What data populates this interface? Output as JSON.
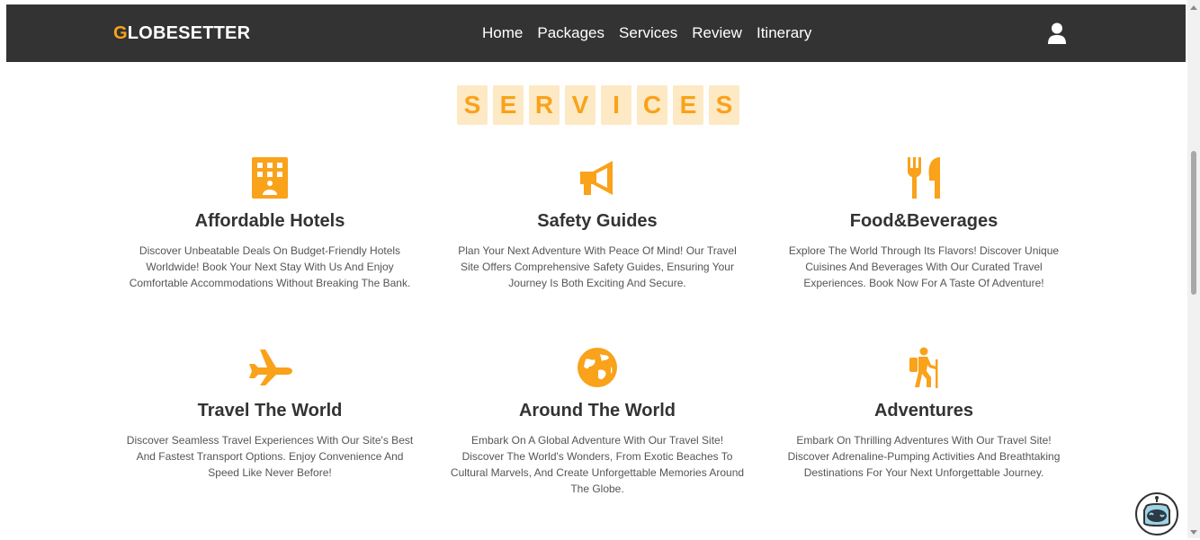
{
  "nav": {
    "logo_first": "G",
    "logo_rest": "LOBESETTER",
    "links": [
      "Home",
      "Packages",
      "Services",
      "Review",
      "Itinerary"
    ],
    "user_icon": "user-icon"
  },
  "section": {
    "title_letters": [
      "S",
      "E",
      "R",
      "V",
      "I",
      "C",
      "E",
      "S"
    ]
  },
  "services": [
    {
      "icon": "hotel-icon",
      "title": "Affordable Hotels",
      "description": "Discover Unbeatable Deals On Budget-Friendly Hotels Worldwide! Book Your Next Stay With Us And Enjoy Comfortable Accommodations Without Breaking The Bank."
    },
    {
      "icon": "megaphone-icon",
      "title": "Safety Guides",
      "description": "Plan Your Next Adventure With Peace Of Mind! Our Travel Site Offers Comprehensive Safety Guides, Ensuring Your Journey Is Both Exciting And Secure."
    },
    {
      "icon": "utensils-icon",
      "title": "Food&Beverages",
      "description": "Explore The World Through Its Flavors! Discover Unique Cuisines And Beverages With Our Curated Travel Experiences. Book Now For A Taste Of Adventure!"
    },
    {
      "icon": "plane-icon",
      "title": "Travel The World",
      "description": "Discover Seamless Travel Experiences With Our Site's Best And Fastest Transport Options. Enjoy Convenience And Speed Like Never Before!"
    },
    {
      "icon": "globe-icon",
      "title": "Around The World",
      "description": "Embark On A Global Adventure With Our Travel Site! Discover The World's Wonders, From Exotic Beaches To Cultural Marvels, And Create Unforgettable Memories Around The Globe."
    },
    {
      "icon": "hiking-icon",
      "title": "Adventures",
      "description": "Embark On Thrilling Adventures With Our Travel Site! Discover Adrenaline-Pumping Activities And Breathtaking Destinations For Your Next Unforgettable Journey."
    }
  ],
  "colors": {
    "accent": "#f9a21a",
    "navbar": "#333333",
    "title_tile": "#fde9c4"
  },
  "chatbot_icon": "chatbot-robot-icon"
}
